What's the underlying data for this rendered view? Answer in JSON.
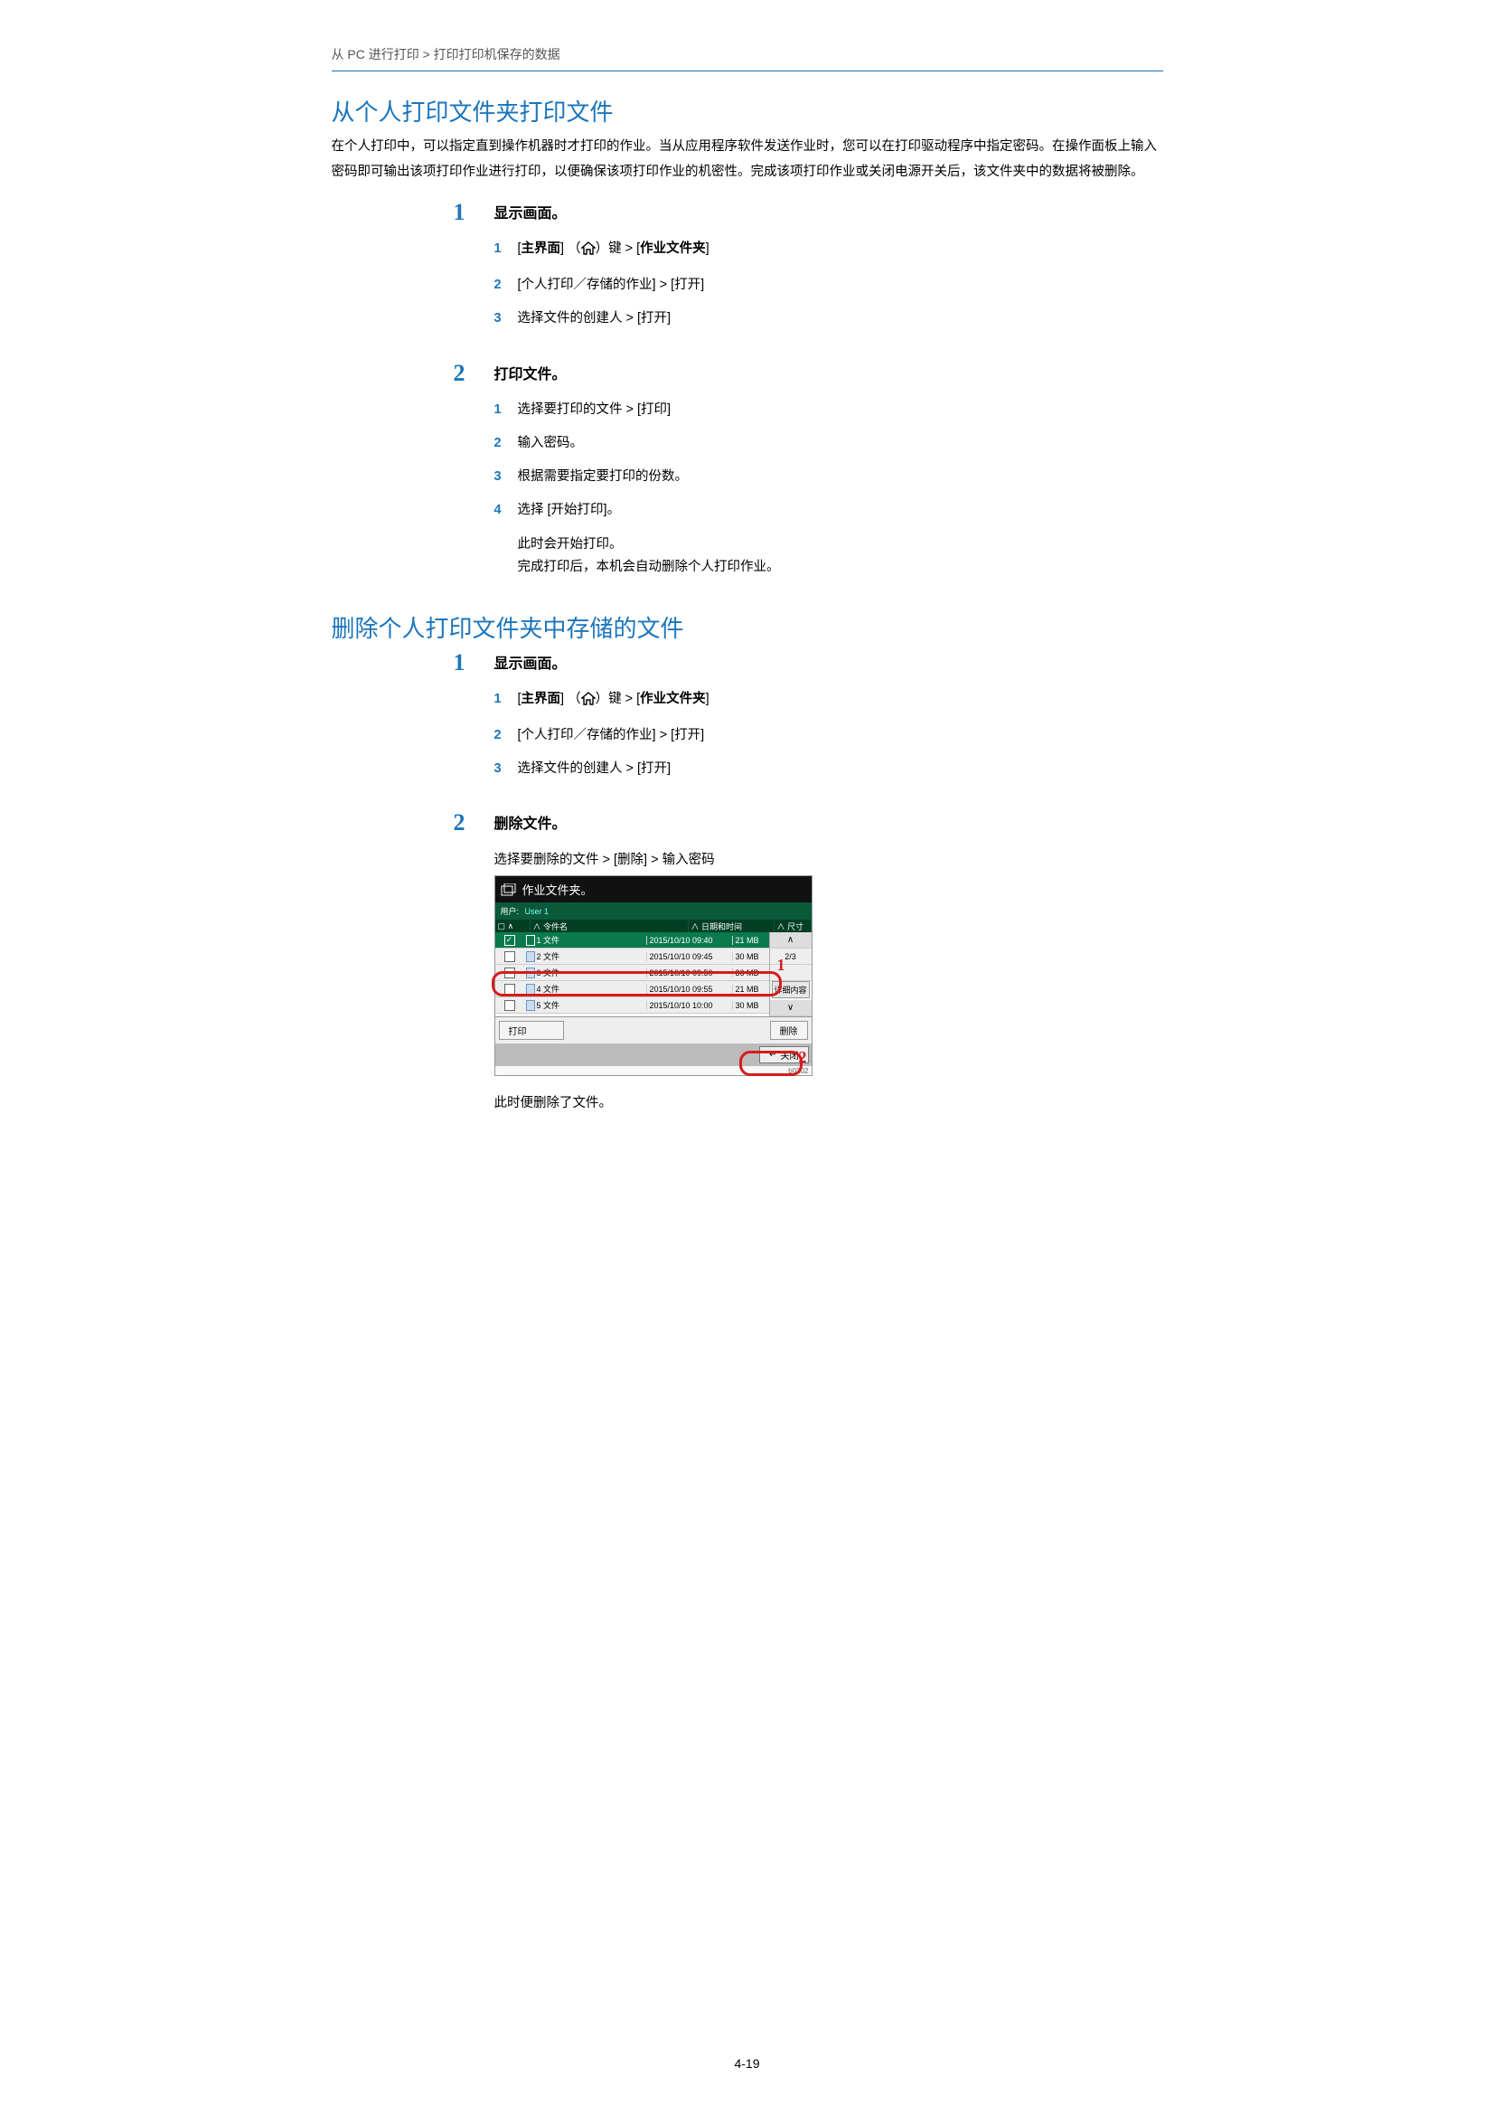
{
  "breadcrumb": "从 PC 进行打印 > 打印打印机保存的数据",
  "section_a": {
    "title": "从个人打印文件夹打印文件",
    "intro": "在个人打印中，可以指定直到操作机器时才打印的作业。当从应用程序软件发送作业时，您可以在打印驱动程序中指定密码。在操作面板上输入密码即可输出该项打印作业进行打印，以便确保该项打印作业的机密性。完成该项打印作业或关闭电源开关后，该文件夹中的数据将被删除。",
    "step1": {
      "num": "1",
      "title": "显示画面。",
      "items": [
        {
          "n": "1",
          "pre": "[",
          "name": "主界面",
          "mid": "] （",
          "post": "）键 > [",
          "name2": "作业文件夹",
          "tail": "]"
        },
        {
          "n": "2",
          "txt": "[个人打印／存储的作业] > [打开]"
        },
        {
          "n": "3",
          "txt": "选择文件的创建人 > [打开]"
        }
      ]
    },
    "step2": {
      "num": "2",
      "title": "打印文件。",
      "items": [
        {
          "n": "1",
          "txt": "选择要打印的文件 > [打印]"
        },
        {
          "n": "2",
          "txt": "输入密码。"
        },
        {
          "n": "3",
          "txt": "根据需要指定要打印的份数。"
        },
        {
          "n": "4",
          "txt": "选择 [开始打印]。"
        }
      ],
      "note1": "此时会开始打印。",
      "note2": "完成打印后，本机会自动删除个人打印作业。"
    }
  },
  "section_b": {
    "title": "删除个人打印文件夹中存储的文件",
    "step1": {
      "num": "1",
      "title": "显示画面。",
      "items": [
        {
          "n": "1",
          "pre": "[",
          "name": "主界面",
          "mid": "] （",
          "post": "）键 > [",
          "name2": "作业文件夹",
          "tail": "]"
        },
        {
          "n": "2",
          "txt": "[个人打印／存储的作业] > [打开]"
        },
        {
          "n": "3",
          "txt": "选择文件的创建人 > [打开]"
        }
      ]
    },
    "step2": {
      "num": "2",
      "title": "删除文件。",
      "lead": "选择要删除的文件 > [删除] > 输入密码",
      "panel": {
        "bar": "作业文件夹。",
        "user_lbl": "用户:",
        "user_val": "User 1",
        "hd_chk": "▢ ∧",
        "hd_name": "∧ 令件名",
        "hd_date": "∧ 日期和时间",
        "hd_size": "∧ 尺寸",
        "rows": [
          {
            "sel": true,
            "name": "1 文件",
            "date": "2015/10/10 09:40",
            "size": "21 MB"
          },
          {
            "sel": false,
            "name": "2 文件",
            "date": "2015/10/10 09:45",
            "size": "30 MB"
          },
          {
            "sel": false,
            "name": "3 文件",
            "date": "2015/10/10 09:50",
            "size": "36 MB"
          },
          {
            "sel": false,
            "name": "4 文件",
            "date": "2015/10/10 09:55",
            "size": "21 MB"
          },
          {
            "sel": false,
            "name": "5 文件",
            "date": "2015/10/10 10:00",
            "size": "30 MB"
          }
        ],
        "page": "2/3",
        "detail": "详细内容",
        "print": "打印",
        "delete": "删除",
        "close": "关闭",
        "code": "b0202"
      },
      "callout1": "1",
      "callout2": "2",
      "endnote": "此时便删除了文件。"
    }
  },
  "pagenum": "4-19"
}
